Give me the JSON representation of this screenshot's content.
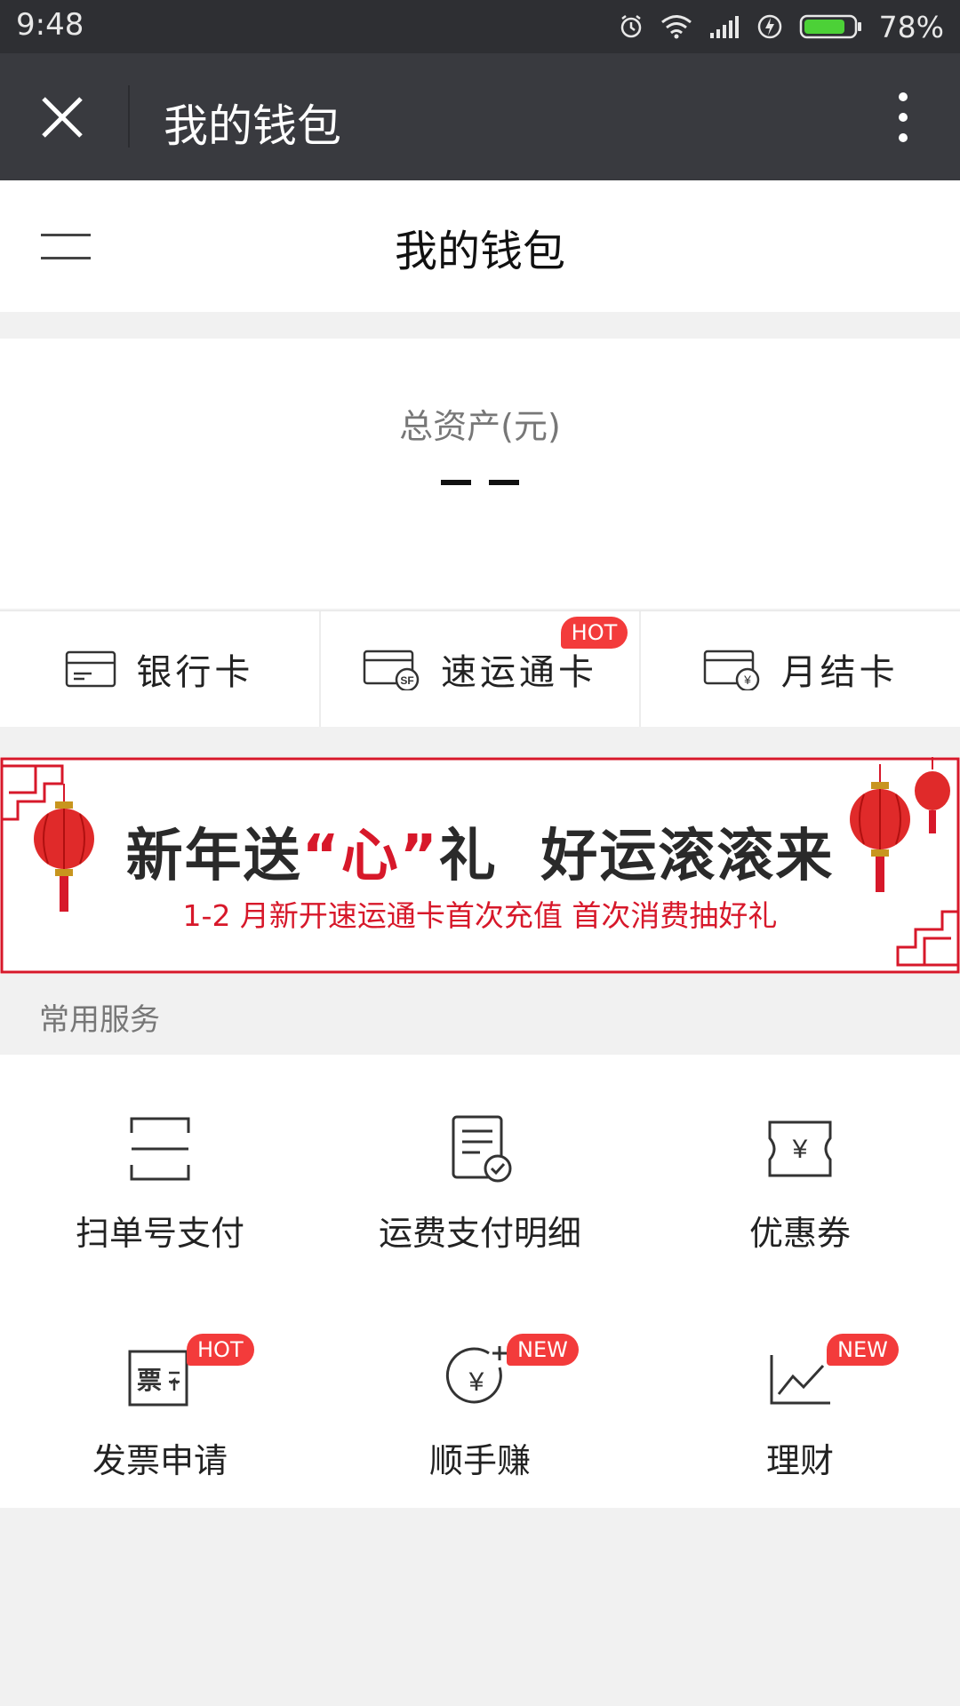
{
  "status_bar": {
    "time": "9:48",
    "battery": "78%"
  },
  "title_bar": {
    "title": "我的钱包"
  },
  "page": {
    "title": "我的钱包"
  },
  "assets": {
    "label": "总资产(元)",
    "value": "– –"
  },
  "cards": [
    {
      "label": "银行卡",
      "icon": "bank-card-icon"
    },
    {
      "label": "速运通卡",
      "icon": "sf-card-icon",
      "badge": "HOT"
    },
    {
      "label": "月结卡",
      "icon": "monthly-card-icon"
    }
  ],
  "banner": {
    "headline_1": "新年送",
    "headline_2": "“心”",
    "headline_3": "礼  好运滚滚来",
    "subtitle": "1-2 月新开速运通卡首次充值 首次消费抽好礼"
  },
  "services": {
    "title": "常用服务",
    "items": [
      {
        "label": "扫单号支付",
        "icon": "scan-icon"
      },
      {
        "label": "运费支付明细",
        "icon": "receipt-check-icon"
      },
      {
        "label": "优惠券",
        "icon": "coupon-icon"
      },
      {
        "label": "发票申请",
        "icon": "invoice-icon",
        "badge": "HOT"
      },
      {
        "label": "顺手赚",
        "icon": "yuan-plus-icon",
        "badge": "NEW"
      },
      {
        "label": "理财",
        "icon": "chart-trend-icon",
        "badge": "NEW"
      }
    ]
  },
  "colors": {
    "accent": "#d7182a",
    "badge": "#f33b3b",
    "titlebar": "#393a3f"
  }
}
